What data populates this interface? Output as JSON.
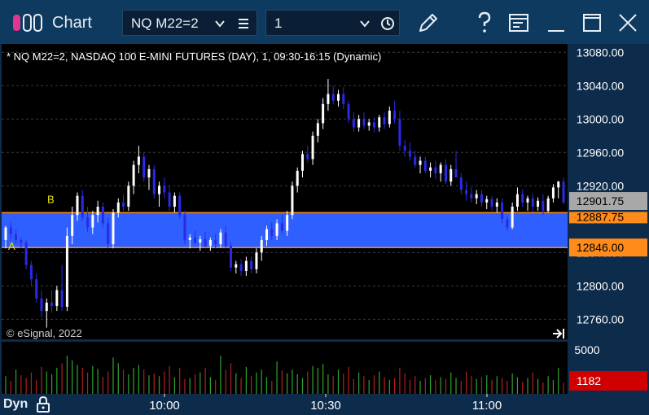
{
  "window": {
    "title": "Chart",
    "symbol": "NQ M22=2",
    "interval": "1"
  },
  "chart": {
    "header": "* NQ M22=2, NASDAQ 100 E-MINI FUTURES (DAY), 1, 09:30-16:15 (Dynamic)",
    "copyright": "© eSignal, 2022",
    "marker_b": "B",
    "marker_a": "A",
    "last_price_label": "12901.75",
    "zone_top_label": "12887.75",
    "zone_bottom_label": "12846.00",
    "volume_tick": "5000",
    "volume_last_label": "1182",
    "dyn_label": "Dyn"
  },
  "colors": {
    "up": "#ffffff",
    "down": "#2a2ae6",
    "zone_fill": "#2f5fff",
    "zone_border": "#ff8c1a",
    "vol_up": "#2fa32f",
    "vol_down": "#b32020",
    "last_price_bg": "#a8a8a8",
    "zone_label_bg": "#ff8c1a",
    "vol_label_bg": "#d00000"
  },
  "chart_data": {
    "type": "candlestick",
    "y_ticks": [
      13080,
      13040,
      13000,
      12960,
      12920,
      12880,
      12840,
      12800,
      12760
    ],
    "y_tick_labels": [
      "13080.00",
      "13040.00",
      "13000.00",
      "12960.00",
      "12920.00",
      "12880.00",
      "12840.00",
      "12800.00",
      "12760.00"
    ],
    "ylim": [
      12736,
      13090
    ],
    "x_tick_labels": [
      "10:00",
      "10:30",
      "11:00"
    ],
    "zone": {
      "low": 12846,
      "high": 12887.75
    },
    "bars": [
      [
        12855,
        12872,
        12845,
        12870
      ],
      [
        12870,
        12876,
        12856,
        12862
      ],
      [
        12862,
        12868,
        12850,
        12855
      ],
      [
        12855,
        12858,
        12845,
        12852
      ],
      [
        12852,
        12855,
        12820,
        12825
      ],
      [
        12825,
        12830,
        12800,
        12808
      ],
      [
        12808,
        12815,
        12780,
        12785
      ],
      [
        12785,
        12795,
        12762,
        12770
      ],
      [
        12770,
        12785,
        12750,
        12780
      ],
      [
        12780,
        12795,
        12768,
        12776
      ],
      [
        12776,
        12800,
        12770,
        12795
      ],
      [
        12795,
        12825,
        12770,
        12775
      ],
      [
        12775,
        12870,
        12770,
        12860
      ],
      [
        12860,
        12895,
        12850,
        12885
      ],
      [
        12885,
        12912,
        12878,
        12908
      ],
      [
        12908,
        12915,
        12878,
        12882
      ],
      [
        12882,
        12895,
        12865,
        12870
      ],
      [
        12870,
        12890,
        12862,
        12885
      ],
      [
        12885,
        12902,
        12876,
        12895
      ],
      [
        12895,
        12900,
        12870,
        12875
      ],
      [
        12875,
        12882,
        12845,
        12850
      ],
      [
        12850,
        12892,
        12845,
        12888
      ],
      [
        12888,
        12905,
        12882,
        12900
      ],
      [
        12900,
        12910,
        12890,
        12895
      ],
      [
        12895,
        12925,
        12890,
        12920
      ],
      [
        12920,
        12950,
        12910,
        12945
      ],
      [
        12945,
        12968,
        12935,
        12955
      ],
      [
        12955,
        12960,
        12925,
        12930
      ],
      [
        12930,
        12945,
        12915,
        12940
      ],
      [
        12940,
        12945,
        12905,
        12910
      ],
      [
        12910,
        12925,
        12895,
        12920
      ],
      [
        12920,
        12930,
        12905,
        12912
      ],
      [
        12912,
        12920,
        12890,
        12895
      ],
      [
        12895,
        12912,
        12888,
        12908
      ],
      [
        12908,
        12912,
        12880,
        12885
      ],
      [
        12885,
        12890,
        12850,
        12855
      ],
      [
        12855,
        12862,
        12845,
        12858
      ],
      [
        12858,
        12866,
        12850,
        12852
      ],
      [
        12852,
        12860,
        12842,
        12856
      ],
      [
        12856,
        12865,
        12846,
        12848
      ],
      [
        12848,
        12858,
        12842,
        12855
      ],
      [
        12855,
        12862,
        12845,
        12850
      ],
      [
        12850,
        12868,
        12846,
        12864
      ],
      [
        12864,
        12872,
        12845,
        12848
      ],
      [
        12848,
        12852,
        12818,
        12822
      ],
      [
        12822,
        12830,
        12815,
        12826
      ],
      [
        12826,
        12832,
        12812,
        12818
      ],
      [
        12818,
        12835,
        12812,
        12830
      ],
      [
        12830,
        12835,
        12815,
        12820
      ],
      [
        12820,
        12845,
        12815,
        12840
      ],
      [
        12840,
        12860,
        12830,
        12855
      ],
      [
        12855,
        12872,
        12848,
        12868
      ],
      [
        12868,
        12876,
        12855,
        12860
      ],
      [
        12860,
        12880,
        12855,
        12875
      ],
      [
        12875,
        12885,
        12862,
        12866
      ],
      [
        12866,
        12890,
        12860,
        12885
      ],
      [
        12885,
        12925,
        12880,
        12920
      ],
      [
        12920,
        12942,
        12912,
        12938
      ],
      [
        12938,
        12962,
        12930,
        12958
      ],
      [
        12958,
        12968,
        12948,
        12952
      ],
      [
        12952,
        12985,
        12945,
        12980
      ],
      [
        12980,
        13000,
        12972,
        12995
      ],
      [
        12995,
        13025,
        12988,
        13018
      ],
      [
        13018,
        13048,
        13010,
        13030
      ],
      [
        13030,
        13040,
        13018,
        13022
      ],
      [
        13022,
        13035,
        13015,
        13030
      ],
      [
        13030,
        13038,
        13012,
        13018
      ],
      [
        13018,
        13022,
        12995,
        13000
      ],
      [
        13000,
        13008,
        12985,
        12990
      ],
      [
        12990,
        13005,
        12985,
        13000
      ],
      [
        13000,
        13008,
        12988,
        12992
      ],
      [
        12992,
        13000,
        12986,
        12996
      ],
      [
        12996,
        13002,
        12984,
        12990
      ],
      [
        12990,
        13005,
        12985,
        13002
      ],
      [
        13002,
        13008,
        12988,
        12994
      ],
      [
        12994,
        13015,
        12990,
        13010
      ],
      [
        13010,
        13022,
        12995,
        13000
      ],
      [
        13000,
        13010,
        12962,
        12968
      ],
      [
        12968,
        12975,
        12955,
        12962
      ],
      [
        12962,
        12972,
        12950,
        12955
      ],
      [
        12955,
        12962,
        12942,
        12945
      ],
      [
        12945,
        12955,
        12935,
        12950
      ],
      [
        12950,
        12955,
        12935,
        12938
      ],
      [
        12938,
        12948,
        12930,
        12942
      ],
      [
        12942,
        12950,
        12928,
        12935
      ],
      [
        12935,
        12948,
        12925,
        12945
      ],
      [
        12945,
        12952,
        12922,
        12925
      ],
      [
        12925,
        12945,
        12920,
        12940
      ],
      [
        12940,
        12962,
        12935,
        12930
      ],
      [
        12930,
        12935,
        12910,
        12915
      ],
      [
        12915,
        12925,
        12902,
        12910
      ],
      [
        12910,
        12918,
        12900,
        12905
      ],
      [
        12905,
        12915,
        12898,
        12910
      ],
      [
        12910,
        12915,
        12895,
        12900
      ],
      [
        12900,
        12908,
        12892,
        12904
      ],
      [
        12904,
        12908,
        12890,
        12895
      ],
      [
        12895,
        12905,
        12888,
        12900
      ],
      [
        12900,
        12905,
        12875,
        12880
      ],
      [
        12880,
        12884,
        12866,
        12870
      ],
      [
        12870,
        12900,
        12868,
        12895
      ],
      [
        12895,
        12918,
        12890,
        12910
      ],
      [
        12910,
        12916,
        12895,
        12900
      ],
      [
        12900,
        12908,
        12890,
        12905
      ],
      [
        12905,
        12910,
        12888,
        12895
      ],
      [
        12895,
        12906,
        12890,
        12902
      ],
      [
        12902,
        12910,
        12885,
        12890
      ],
      [
        12890,
        12908,
        12888,
        12905
      ],
      [
        12905,
        12922,
        12900,
        12918
      ],
      [
        12918,
        12926,
        12905,
        12925
      ],
      [
        12925,
        12930,
        12898,
        12900
      ]
    ],
    "volume": [
      [
        1900,
        1
      ],
      [
        1400,
        0
      ],
      [
        2600,
        1
      ],
      [
        2000,
        0
      ],
      [
        1700,
        0
      ],
      [
        2300,
        0
      ],
      [
        1500,
        0
      ],
      [
        2900,
        0
      ],
      [
        2400,
        1
      ],
      [
        2100,
        1
      ],
      [
        2800,
        1
      ],
      [
        3300,
        0
      ],
      [
        4100,
        1
      ],
      [
        3600,
        1
      ],
      [
        3100,
        1
      ],
      [
        2800,
        0
      ],
      [
        2300,
        0
      ],
      [
        3000,
        1
      ],
      [
        2700,
        1
      ],
      [
        1800,
        0
      ],
      [
        2400,
        0
      ],
      [
        3900,
        1
      ],
      [
        3300,
        1
      ],
      [
        2600,
        0
      ],
      [
        2100,
        1
      ],
      [
        2800,
        1
      ],
      [
        3100,
        1
      ],
      [
        2600,
        0
      ],
      [
        2000,
        1
      ],
      [
        2200,
        0
      ],
      [
        1900,
        1
      ],
      [
        2400,
        0
      ],
      [
        3000,
        0
      ],
      [
        1800,
        1
      ],
      [
        2800,
        0
      ],
      [
        1600,
        0
      ],
      [
        1700,
        1
      ],
      [
        2100,
        0
      ],
      [
        2300,
        1
      ],
      [
        2800,
        0
      ],
      [
        1800,
        1
      ],
      [
        1500,
        0
      ],
      [
        4100,
        1
      ],
      [
        2600,
        0
      ],
      [
        3300,
        0
      ],
      [
        2200,
        1
      ],
      [
        1700,
        0
      ],
      [
        2900,
        1
      ],
      [
        1900,
        0
      ],
      [
        2300,
        1
      ],
      [
        2600,
        1
      ],
      [
        1800,
        1
      ],
      [
        1400,
        0
      ],
      [
        3500,
        1
      ],
      [
        2500,
        0
      ],
      [
        2200,
        1
      ],
      [
        2600,
        1
      ],
      [
        2100,
        1
      ],
      [
        1700,
        1
      ],
      [
        2400,
        0
      ],
      [
        3000,
        1
      ],
      [
        2800,
        1
      ],
      [
        3200,
        1
      ],
      [
        2100,
        1
      ],
      [
        1900,
        0
      ],
      [
        2600,
        1
      ],
      [
        2200,
        0
      ],
      [
        2900,
        0
      ],
      [
        1600,
        0
      ],
      [
        2300,
        1
      ],
      [
        1900,
        0
      ],
      [
        1500,
        1
      ],
      [
        2000,
        0
      ],
      [
        2400,
        1
      ],
      [
        1800,
        0
      ],
      [
        1500,
        1
      ],
      [
        1700,
        0
      ],
      [
        2800,
        0
      ],
      [
        2200,
        0
      ],
      [
        1500,
        0
      ],
      [
        1900,
        0
      ],
      [
        1400,
        1
      ],
      [
        1700,
        0
      ],
      [
        2000,
        1
      ],
      [
        1500,
        0
      ],
      [
        1800,
        1
      ],
      [
        1600,
        0
      ],
      [
        2300,
        1
      ],
      [
        1700,
        1
      ],
      [
        1400,
        0
      ],
      [
        2400,
        0
      ],
      [
        1900,
        0
      ],
      [
        1600,
        1
      ],
      [
        1800,
        0
      ],
      [
        2000,
        1
      ],
      [
        1500,
        0
      ],
      [
        1900,
        1
      ],
      [
        1700,
        0
      ],
      [
        1400,
        0
      ],
      [
        2200,
        1
      ],
      [
        1800,
        1
      ],
      [
        1300,
        0
      ],
      [
        1700,
        1
      ],
      [
        2300,
        0
      ],
      [
        1600,
        1
      ],
      [
        1200,
        0
      ],
      [
        1900,
        1
      ],
      [
        1500,
        1
      ],
      [
        2800,
        1
      ],
      [
        1182,
        0
      ]
    ],
    "volume_max": 5600
  }
}
